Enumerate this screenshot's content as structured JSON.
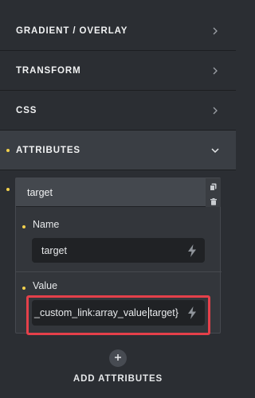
{
  "sections": {
    "gradient": "GRADIENT / OVERLAY",
    "transform": "TRANSFORM",
    "css": "CSS",
    "attributes": "ATTRIBUTES"
  },
  "attribute_item": {
    "header": "target",
    "name_label": "Name",
    "name_value": "target",
    "value_label": "Value",
    "value_before_caret": "_custom_link:array_value",
    "value_after_caret": "target}"
  },
  "add_button": {
    "symbol": "+",
    "label": "ADD ATTRIBUTES"
  },
  "colors": {
    "background": "#2b2e33",
    "active_row": "#3a3e44",
    "indicator_dot": "#f2d14d",
    "highlight": "#e5404a",
    "input_bg": "#202225"
  },
  "icons": {
    "collapsed": "chevron-right-icon",
    "expanded": "chevron-down-icon",
    "dynamic_data": "bolt-icon",
    "clone": "copy-icon",
    "remove": "trash-icon",
    "add": "plus-icon"
  }
}
